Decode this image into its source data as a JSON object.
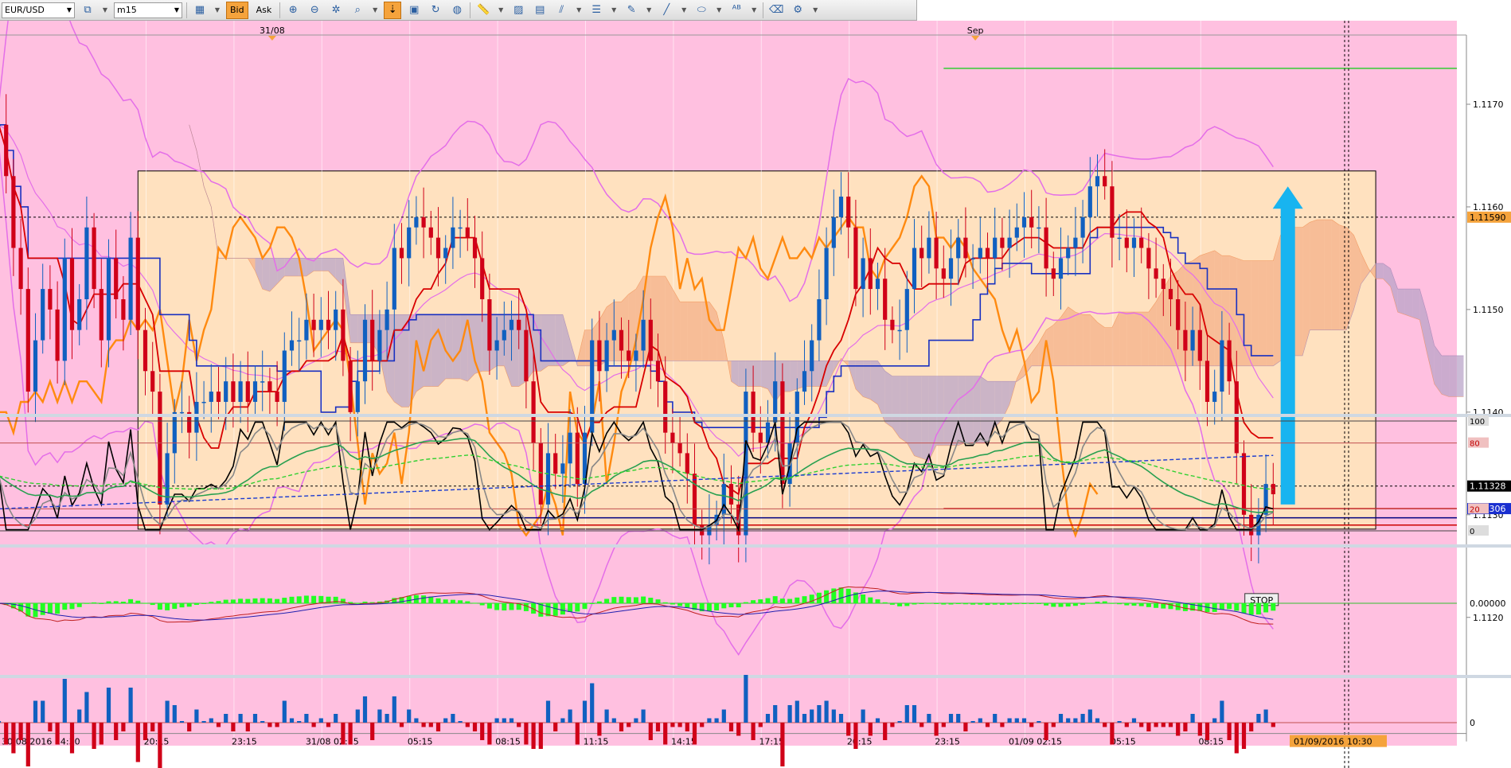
{
  "toolbar": {
    "symbol": "EUR/USD",
    "timeframe": "m15",
    "bid_label": "Bid",
    "ask_label": "Ask"
  },
  "chart_data": {
    "type": "candlestick",
    "symbol": "EUR/USD",
    "timeframe": "m15",
    "price_axis": {
      "ylim": [
        1.1112,
        1.118
      ],
      "ticks": [
        "1.1170",
        "1.1160",
        "1.1150",
        "1.1140",
        "1.1130",
        "1.1120"
      ],
      "ticks_values": [
        1.117,
        1.116,
        1.115,
        1.114,
        1.113,
        1.112
      ],
      "markers": [
        {
          "label": "1.11590",
          "value": 1.1159,
          "bg": "#f5a33c",
          "fg": "#000000"
        },
        {
          "label": "1.11328",
          "value": 1.11328,
          "bg": "#000000",
          "fg": "#ffffff"
        },
        {
          "label": "1.11306",
          "value": 1.11306,
          "bg": "#1a2fd0",
          "fg": "#ffffff"
        }
      ]
    },
    "time_axis": {
      "labels": [
        "30/08/2016 14:30",
        "20:15",
        "23:15",
        "31/08 02:15",
        "05:15",
        "08:15",
        "11:15",
        "14:15",
        "17:15",
        "20:15",
        "23:15",
        "01/09 02:15",
        "05:15",
        "08:15"
      ],
      "label_bars": [
        0,
        20,
        32,
        44,
        56,
        68,
        80,
        92,
        104,
        116,
        128,
        140,
        152,
        164
      ],
      "current_time": "01/09 10:30",
      "current_time_label": "01/09/2016 10:30"
    },
    "date_markers": [
      {
        "label": "31/08",
        "bar": 37
      },
      {
        "label": "Sep",
        "bar": 133
      }
    ],
    "candles": {
      "bar_count": 175,
      "open_first": 1.1168,
      "close": [
        1.1168,
        1.1163,
        1.1156,
        1.1152,
        1.1142,
        1.1147,
        1.1152,
        1.115,
        1.1145,
        1.1155,
        1.1148,
        1.1151,
        1.1158,
        1.1152,
        1.1147,
        1.1155,
        1.1151,
        1.1149,
        1.1157,
        1.1148,
        1.1144,
        1.1142,
        1.1131,
        1.1136,
        1.114,
        1.114,
        1.1138,
        1.1141,
        1.1141,
        1.1142,
        1.1141,
        1.1143,
        1.1141,
        1.1143,
        1.1141,
        1.1143,
        1.1143,
        1.1142,
        1.1141,
        1.1146,
        1.1147,
        1.1147,
        1.1149,
        1.1148,
        1.1149,
        1.1148,
        1.115,
        1.1145,
        1.114,
        1.1143,
        1.1149,
        1.1145,
        1.1148,
        1.115,
        1.1156,
        1.1155,
        1.1158,
        1.1159,
        1.1158,
        1.1157,
        1.1155,
        1.1156,
        1.1158,
        1.1158,
        1.1157,
        1.1155,
        1.1151,
        1.1146,
        1.1147,
        1.1148,
        1.1149,
        1.1148,
        1.1143,
        1.1137,
        1.1131,
        1.1136,
        1.1134,
        1.1135,
        1.1138,
        1.1133,
        1.1138,
        1.1147,
        1.1144,
        1.1147,
        1.1148,
        1.1146,
        1.1145,
        1.1146,
        1.1149,
        1.1145,
        1.1143,
        1.1138,
        1.1137,
        1.1136,
        1.1134,
        1.1129,
        1.1128,
        1.1129,
        1.113,
        1.1133,
        1.1131,
        1.1128,
        1.1142,
        1.1138,
        1.1137,
        1.1139,
        1.1143,
        1.1133,
        1.1137,
        1.1142,
        1.1144,
        1.1147,
        1.1151,
        1.1156,
        1.1159,
        1.1161,
        1.1158,
        1.1152,
        1.1155,
        1.1152,
        1.1153,
        1.1149,
        1.1148,
        1.1148,
        1.1152,
        1.1156,
        1.1155,
        1.1157,
        1.1154,
        1.1153,
        1.1155,
        1.1157,
        1.1155,
        1.1155,
        1.1156,
        1.1155,
        1.1157,
        1.1156,
        1.1157,
        1.1158,
        1.1159,
        1.1158,
        1.1158,
        1.1154,
        1.1153,
        1.1155,
        1.1156,
        1.1157,
        1.1159,
        1.1162,
        1.1163,
        1.1162,
        1.1157,
        1.1157,
        1.1156,
        1.1157,
        1.1156,
        1.1154,
        1.1153,
        1.1152,
        1.1151,
        1.1148,
        1.1146,
        1.1148,
        1.1145,
        1.1141,
        1.1142,
        1.1147,
        1.1143,
        1.1136,
        1.113,
        1.1128,
        1.113,
        1.1133,
        1.1132
      ]
    },
    "horizontal_lines": [
      {
        "value": 1.11735,
        "color": "#33cc33",
        "from_bar": 129
      },
      {
        "value": 1.11306,
        "color": "#cc0000",
        "from_bar": 129
      },
      {
        "value": 1.11297,
        "color": "#000080",
        "from_bar": 0
      },
      {
        "value": 1.1129,
        "color": "#cc0000",
        "from_bar": 0
      }
    ],
    "range_box": {
      "from_bar": 19,
      "to_bar": 188,
      "top": 1.11635,
      "bottom": 1.11286
    },
    "annotations": [
      {
        "type": "arrow_up",
        "bar": 176,
        "from": 1.1131,
        "to": 1.1162,
        "color": "#18b4f0"
      },
      {
        "type": "label",
        "text": "STOP",
        "bar": 171,
        "value": 1.11217
      }
    ],
    "stochastic": {
      "levels": [
        100,
        80,
        20,
        0
      ],
      "level_labels": [
        "100",
        "80",
        "20",
        "0"
      ]
    },
    "macd": {
      "zero_label": "0.00000"
    },
    "histogram": {
      "zero_label": "0"
    }
  }
}
